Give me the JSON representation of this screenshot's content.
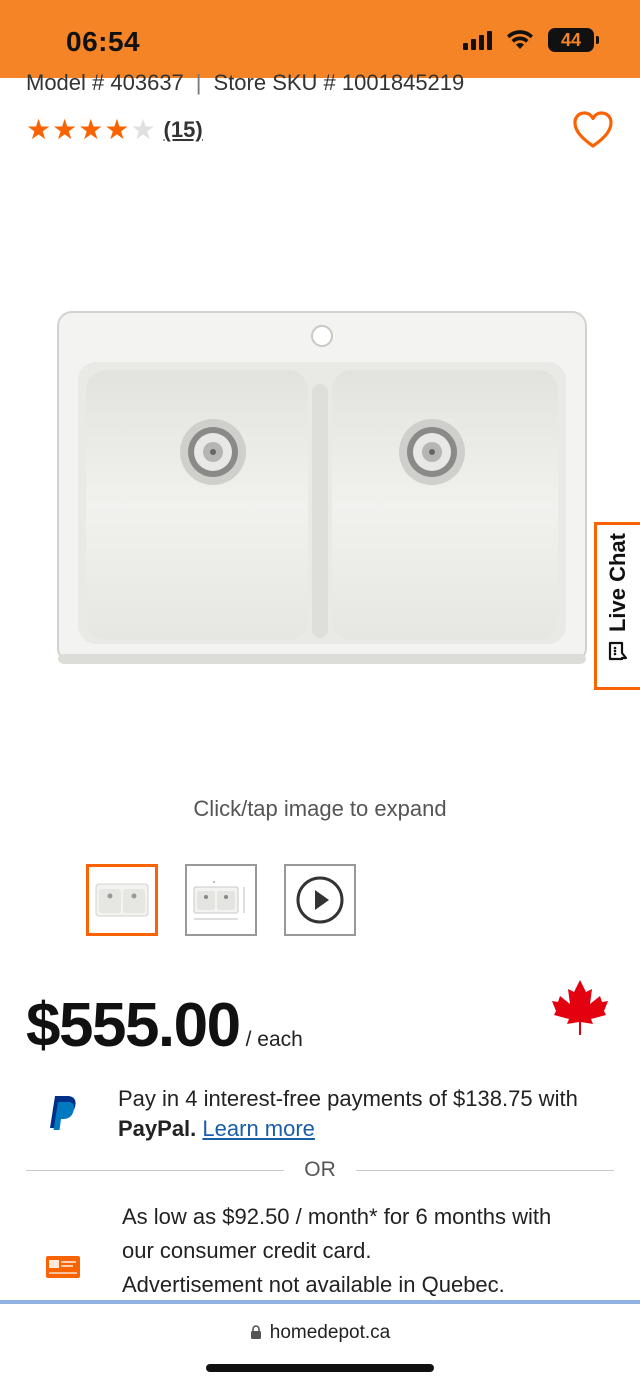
{
  "status_bar": {
    "time": "06:54",
    "battery": "44",
    "background_color": "#f58426"
  },
  "product": {
    "model_label": "Model # 403637",
    "store_sku_label": "Store SKU # 1001845219",
    "rating": 4,
    "rating_max": 5,
    "review_count": "(15)",
    "expand_hint": "Click/tap image to expand",
    "thumbnails": [
      {
        "kind": "image",
        "selected": true
      },
      {
        "kind": "dimension-image",
        "selected": false
      },
      {
        "kind": "video",
        "selected": false
      }
    ]
  },
  "live_chat": {
    "label": "Live Chat"
  },
  "pricing": {
    "price": "$555.00",
    "unit": "/ each",
    "flag_icon": "maple-leaf-icon"
  },
  "paypal": {
    "text": "Pay in 4 interest-free payments of $138.75 with",
    "brand": "PayPal.",
    "link": "Learn more"
  },
  "divider": {
    "or_label": "OR"
  },
  "credit": {
    "line1": "As low as $92.50 / month* for 6 months with",
    "line2": "our consumer credit card.",
    "line3": "Advertisement not available in Quebec."
  },
  "browser": {
    "url": "homedepot.ca"
  },
  "colors": {
    "accent": "#f96302",
    "link": "#1a5ea8"
  }
}
